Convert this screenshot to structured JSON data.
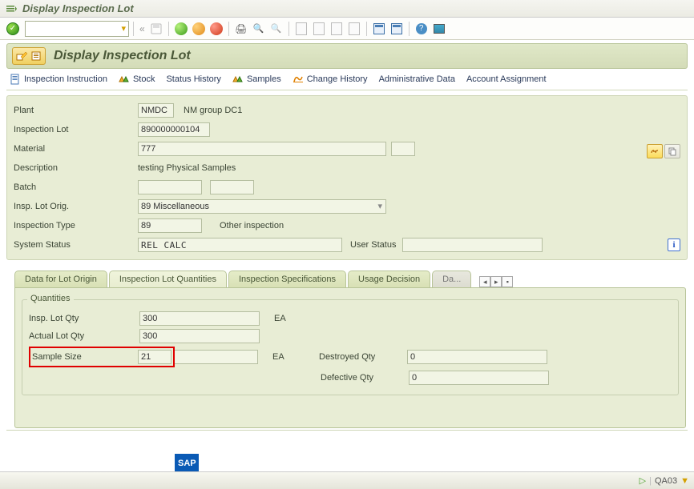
{
  "window_title": "Display Inspection Lot",
  "page_title": "Display Inspection Lot",
  "sub_toolbar": {
    "inspection_instruction": "Inspection Instruction",
    "stock": "Stock",
    "status_history": "Status History",
    "samples": "Samples",
    "change_history": "Change History",
    "admin_data": "Administrative Data",
    "account_assignment": "Account Assignment"
  },
  "labels": {
    "plant": "Plant",
    "inspection_lot": "Inspection Lot",
    "material": "Material",
    "description": "Description",
    "batch": "Batch",
    "insp_lot_orig": "Insp. Lot Orig.",
    "inspection_type": "Inspection Type",
    "system_status": "System Status",
    "user_status": "User Status"
  },
  "fields": {
    "plant": "NMDC",
    "plant_desc": "NM group DC1",
    "inspection_lot": "890000000104",
    "material": "777",
    "description": "testing Physical Samples",
    "batch": "",
    "batch2": "",
    "insp_lot_orig": "89 Miscellaneous",
    "inspection_type": "89",
    "inspection_type_desc": "Other inspection",
    "system_status": "REL   CALC",
    "user_status": ""
  },
  "tabs": {
    "t1": "Data for Lot Origin",
    "t2": "Inspection Lot Quantities",
    "t3": "Inspection Specifications",
    "t4": "Usage Decision",
    "t5": "Da..."
  },
  "quantities": {
    "group": "Quantities",
    "insp_lot_qty_label": "Insp. Lot Qty",
    "insp_lot_qty": "300",
    "insp_lot_qty_unit": "EA",
    "actual_lot_qty_label": "Actual Lot Qty",
    "actual_lot_qty": "300",
    "sample_size_label": "Sample Size",
    "sample_size": "21",
    "sample_size_unit": "EA",
    "destroyed_qty_label": "Destroyed Qty",
    "destroyed_qty": "0",
    "defective_qty_label": "Defective Qty",
    "defective_qty": "0"
  },
  "statusbar": {
    "tcode": "QA03",
    "sap": "SAP"
  },
  "info_glyph": "i"
}
